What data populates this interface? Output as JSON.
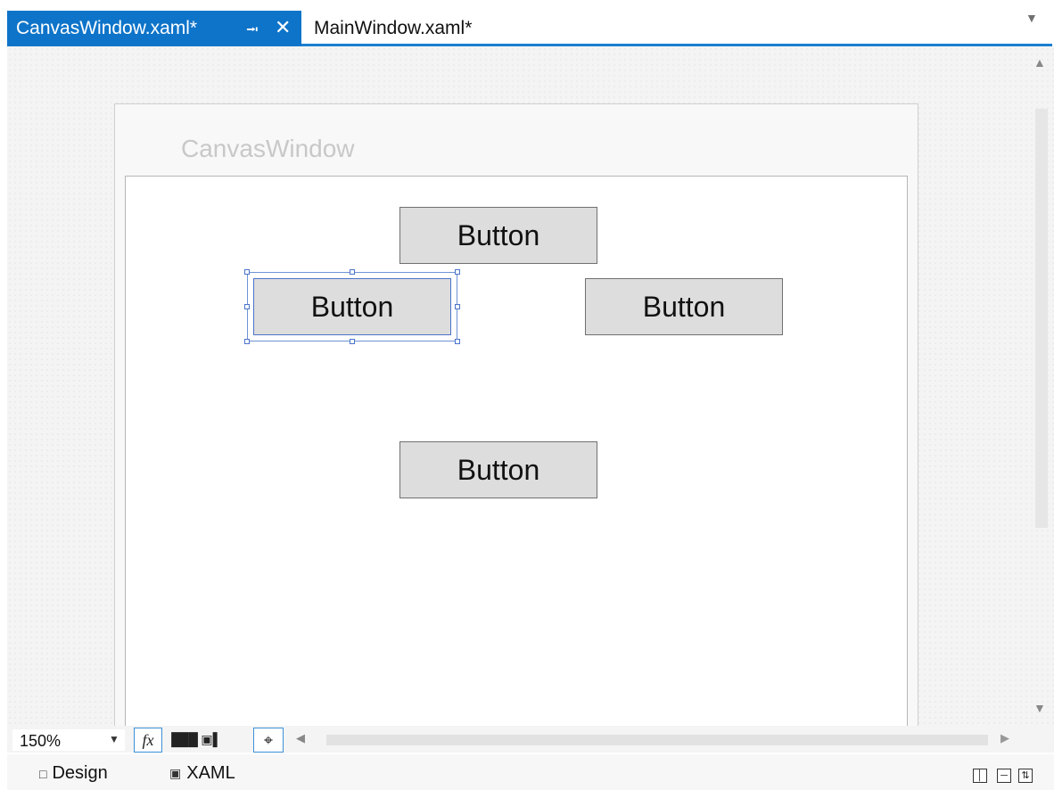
{
  "tabs": [
    {
      "label": "CanvasWindow.xaml*",
      "active": true
    },
    {
      "label": "MainWindow.xaml*",
      "active": false
    }
  ],
  "icons": {
    "pin": "pin-icon",
    "close": "close-icon",
    "tab_dropdown": "chevron-down-icon",
    "fx": "fx",
    "design_view": "design-view-icon",
    "xaml_view": "xaml-view-icon"
  },
  "window": {
    "title": "CanvasWindow",
    "buttons": [
      "Button",
      "Button",
      "Button",
      "Button"
    ]
  },
  "toolbar": {
    "zoom": "150%",
    "fx_label": "fx"
  },
  "view_tabs": {
    "design": "Design",
    "xaml": "XAML"
  },
  "colors": {
    "accent": "#0e74c9",
    "selection": "#4a74c9"
  }
}
